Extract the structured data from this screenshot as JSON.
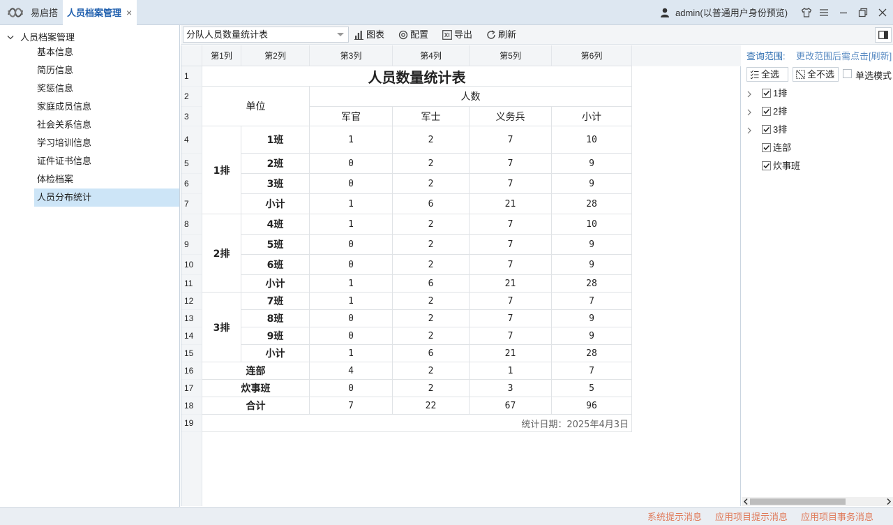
{
  "window": {
    "app_name": "易启搭",
    "tab_title": "人员档案管理",
    "tab_close": "×",
    "user": "admin(以普通用户身份预览)"
  },
  "sidebar": {
    "root": "人员档案管理",
    "items": [
      {
        "label": "基本信息"
      },
      {
        "label": "简历信息"
      },
      {
        "label": "奖惩信息"
      },
      {
        "label": "家庭成员信息"
      },
      {
        "label": "社会关系信息"
      },
      {
        "label": "学习培训信息"
      },
      {
        "label": "证件证书信息"
      },
      {
        "label": "体检档案"
      },
      {
        "label": "人员分布统计",
        "selected": true
      }
    ]
  },
  "toolbar": {
    "report_select": "分队人员数量统计表",
    "chart": "图表",
    "config": "配置",
    "export": "导出",
    "refresh": "刷新"
  },
  "sheet": {
    "columns": [
      "第1列",
      "第2列",
      "第3列",
      "第4列",
      "第5列",
      "第6列"
    ],
    "row_numbers": [
      "1",
      "2",
      "3",
      "4",
      "5",
      "6",
      "7",
      "8",
      "9",
      "10",
      "11",
      "12",
      "13",
      "14",
      "15",
      "16",
      "17",
      "18",
      "19"
    ],
    "title": "人员数量统计表",
    "unit_header": "单位",
    "count_header": "人数",
    "sub_headers": [
      "军官",
      "军士",
      "义务兵",
      "小计"
    ],
    "groups": [
      {
        "name": "1排",
        "rows": [
          {
            "label": "1班",
            "values": [
              "1",
              "2",
              "7",
              "10"
            ]
          },
          {
            "label": "2班",
            "values": [
              "0",
              "2",
              "7",
              "9"
            ]
          },
          {
            "label": "3班",
            "values": [
              "0",
              "2",
              "7",
              "9"
            ]
          },
          {
            "label": "小计",
            "values": [
              "1",
              "6",
              "21",
              "28"
            ]
          }
        ]
      },
      {
        "name": "2排",
        "rows": [
          {
            "label": "4班",
            "values": [
              "1",
              "2",
              "7",
              "10"
            ]
          },
          {
            "label": "5班",
            "values": [
              "0",
              "2",
              "7",
              "9"
            ]
          },
          {
            "label": "6班",
            "values": [
              "0",
              "2",
              "7",
              "9"
            ]
          },
          {
            "label": "小计",
            "values": [
              "1",
              "6",
              "21",
              "28"
            ]
          }
        ]
      },
      {
        "name": "3排",
        "rows": [
          {
            "label": "7班",
            "values": [
              "1",
              "2",
              "7",
              "7"
            ]
          },
          {
            "label": "8班",
            "values": [
              "0",
              "2",
              "7",
              "9"
            ]
          },
          {
            "label": "9班",
            "values": [
              "0",
              "2",
              "7",
              "9"
            ]
          },
          {
            "label": "小计",
            "values": [
              "1",
              "6",
              "21",
              "28"
            ]
          }
        ]
      }
    ],
    "extra_rows": [
      {
        "label": "连部",
        "values": [
          "4",
          "2",
          "1",
          "7"
        ]
      },
      {
        "label": "炊事班",
        "values": [
          "0",
          "2",
          "3",
          "5"
        ]
      },
      {
        "label": "合计",
        "values": [
          "7",
          "22",
          "67",
          "96"
        ]
      }
    ],
    "footer": "统计日期：2025年4月3日"
  },
  "panel": {
    "scope_label": "查询范围:",
    "scope_hint": "更改范围后需点击[刷新]",
    "select_all": "全选",
    "select_none": "全不选",
    "single_mode": "单选模式",
    "tree": [
      {
        "label": "1排",
        "checked": true,
        "expandable": true
      },
      {
        "label": "2排",
        "checked": true,
        "expandable": true
      },
      {
        "label": "3排",
        "checked": true,
        "expandable": true
      },
      {
        "label": "连部",
        "checked": true,
        "expandable": false
      },
      {
        "label": "炊事班",
        "checked": true,
        "expandable": false
      }
    ]
  },
  "statusbar": {
    "messages": [
      "系统提示消息",
      "应用项目提示消息",
      "应用项目事务消息"
    ]
  },
  "colors": {
    "accent": "#1f5fae",
    "selected_bg": "#cde5f7",
    "status_text": "#e07a5a",
    "checkbox": "#222222"
  }
}
